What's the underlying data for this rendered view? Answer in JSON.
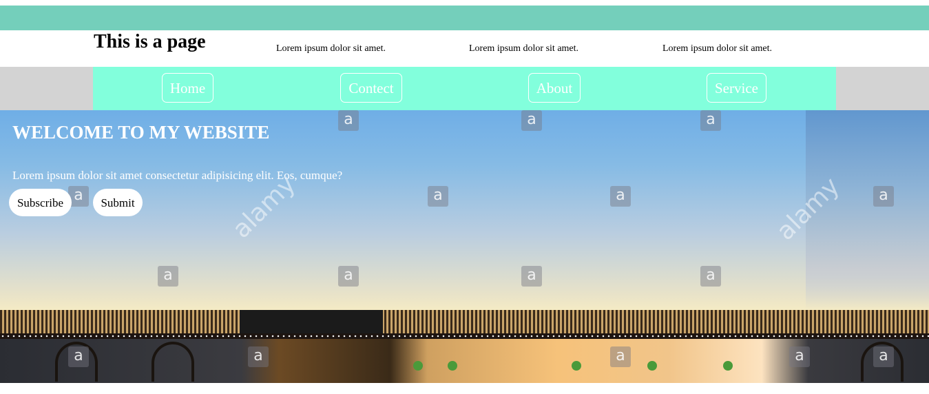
{
  "header": {
    "title": "This is a page",
    "texts": [
      "Lorem ipsum dolor sit amet.",
      "Lorem ipsum dolor sit amet.",
      "Lorem ipsum dolor sit amet."
    ]
  },
  "nav": {
    "items": [
      {
        "label": "Home"
      },
      {
        "label": "Contect"
      },
      {
        "label": "About"
      },
      {
        "label": "Service"
      }
    ]
  },
  "hero": {
    "title": "WELCOME TO MY WEBSITE",
    "text": "Lorem ipsum dolor sit amet consectetur adipisicing elit. Eos, cumque?",
    "buttons": [
      {
        "label": "Subscribe"
      },
      {
        "label": "Submit"
      }
    ],
    "watermark_letter": "a",
    "watermark_text": "alamy"
  },
  "colors": {
    "top_bar": "#74cfbb",
    "nav_background": "#82ffdc",
    "nav_outer": "#d3d3d3"
  }
}
